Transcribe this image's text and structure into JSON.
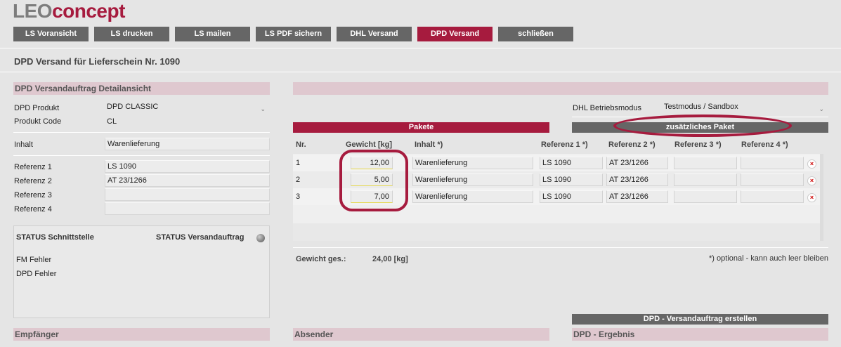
{
  "logo": {
    "part1": "LEO",
    "part2": "concept"
  },
  "nav": [
    "LS Voransicht",
    "LS drucken",
    "LS mailen",
    "LS PDF sichern",
    "DHL Versand",
    "DPD Versand",
    "schließen"
  ],
  "page_title": "DPD Versand für Lieferschein Nr. 1090",
  "left": {
    "section_title": "DPD Versandauftrag Detailansicht",
    "produkt_label": "DPD Produkt",
    "produkt_value": "DPD CLASSIC",
    "code_label": "Produkt Code",
    "code_value": "CL",
    "inhalt_label": "Inhalt",
    "inhalt_value": "Warenlieferung",
    "ref1_label": "Referenz 1",
    "ref1_value": "LS 1090",
    "ref2_label": "Referenz 2",
    "ref2_value": "AT 23/1266",
    "ref3_label": "Referenz 3",
    "ref3_value": "",
    "ref4_label": "Referenz 4",
    "ref4_value": ""
  },
  "status": {
    "schnittstelle": "STATUS Schnittstelle",
    "versandauftrag": "STATUS Versandauftrag",
    "fm_fehler": "FM Fehler",
    "dpd_fehler": "DPD Fehler",
    "indicator_color": "#8a8a8a"
  },
  "right": {
    "mode_label": "DHL Betriebsmodus",
    "mode_value": "Testmodus / Sandbox",
    "pakete_title": "Pakete",
    "add_package": "zusätzliches Paket",
    "columns": [
      "Nr.",
      "Gewicht [kg]",
      "Inhalt *)",
      "Referenz 1 *)",
      "Referenz 2 *)",
      "Referenz 3 *)",
      "Referenz 4 *)"
    ],
    "rows": [
      {
        "nr": "1",
        "gewicht": "12,00",
        "inhalt": "Warenlieferung",
        "ref1": "LS 1090",
        "ref2": "AT 23/1266",
        "ref3": "",
        "ref4": ""
      },
      {
        "nr": "2",
        "gewicht": "5,00",
        "inhalt": "Warenlieferung",
        "ref1": "LS 1090",
        "ref2": "AT 23/1266",
        "ref3": "",
        "ref4": ""
      },
      {
        "nr": "3",
        "gewicht": "7,00",
        "inhalt": "Warenlieferung",
        "ref1": "LS 1090",
        "ref2": "AT 23/1266",
        "ref3": "",
        "ref4": ""
      }
    ],
    "delete_icon": "×",
    "gewicht_ges_label": "Gewicht ges.:",
    "gewicht_ges_value": "24,00 [kg]",
    "optional_note": "*) optional - kann auch leer bleiben",
    "create_button": "DPD - Versandauftrag erstellen"
  },
  "bottom": {
    "empfaenger": "Empfänger",
    "absender": "Absender",
    "ergebnis": "DPD - Ergebnis"
  },
  "colors": {
    "accent": "#a61b3e",
    "grey_button": "#666666",
    "section_bg": "#dfc8cf"
  }
}
